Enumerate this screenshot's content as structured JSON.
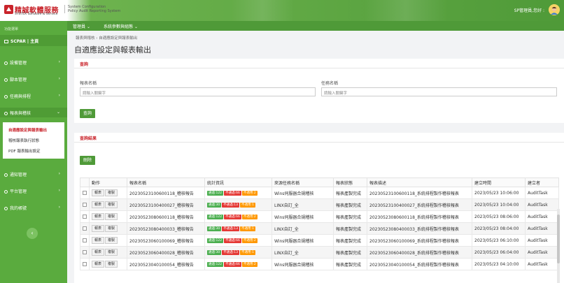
{
  "colors": {
    "brand_red": "#c9242b",
    "brand_green": "#4f9a38",
    "sidebar_green": "#5aab3e",
    "pass": "#4caf50",
    "fail": "#e53935",
    "na": "#ff9800"
  },
  "header": {
    "logo_name": "精誠軟體服務",
    "logo_sub": "SYSTEX Software & Service",
    "system_line1": "System Configuration",
    "system_line2": "Policy Audit Reporting System",
    "user_greeting": "SP管理員,您好 :",
    "avatar_icon": "user-avatar-icon"
  },
  "sidebar": {
    "section_label": "功能選單",
    "home_label": "SCPAR | 主頁",
    "items": [
      {
        "label": "設備管理"
      },
      {
        "label": "腳本管理"
      },
      {
        "label": "任務與排程"
      },
      {
        "label": "報表與稽核"
      },
      {
        "label": "通知管理"
      },
      {
        "label": "平台管理"
      },
      {
        "label": "我的帳號"
      }
    ],
    "submenu": [
      {
        "label": "自適應設定與報表輸出"
      },
      {
        "label": "稽核報表執行狀態"
      },
      {
        "label": "PDF 報表輸出設定"
      }
    ],
    "collapse_icon": "chevron-left-icon"
  },
  "menubar": {
    "items": [
      {
        "label": "管理員"
      },
      {
        "label": "系統參數與組態"
      }
    ]
  },
  "breadcrumb": "報表與稽核 › 自適應設定與報表輸出",
  "page_title": "自適應設定與報表輸出",
  "query": {
    "title": "查詢",
    "report_name_label": "報表名稱",
    "report_name_placeholder": "請輸入關鍵字",
    "task_name_label": "任務名稱",
    "task_name_placeholder": "請輸入關鍵字",
    "search_button": "查詢"
  },
  "results": {
    "title": "查詢結果",
    "delete_button": "刪除",
    "columns": [
      "動作",
      "報表名稱",
      "統計資訊",
      "來源任務名稱",
      "報表狀態",
      "報表描述",
      "建立時間",
      "建立者"
    ],
    "action_report": "報表",
    "action_copy": "複製",
    "stat_pass_prefix": "通過",
    "stat_fail_prefix": "不通過",
    "stat_na_prefix": "不適用",
    "rows": [
      {
        "name": "20230523100600118_稽核報告",
        "pass": "122",
        "fail": "66",
        "na": "2",
        "source": "Wins伺服器合規稽核",
        "status": "報表產製完成",
        "desc": "20230523100600118_系統排程製作稽核報表",
        "time": "2023/05/23 10:06:00",
        "creator": "AuditTask"
      },
      {
        "name": "20230523100400027_稽核報告",
        "pass": "30",
        "fail": "13",
        "na": "1",
        "source": "LINX自訂_全",
        "status": "報表產製完成",
        "desc": "20230523100400027_系統排程製作稽核報表",
        "time": "2023/05/23 10:04:00",
        "creator": "AuditTask"
      },
      {
        "name": "20230523080600118_稽核報告",
        "pass": "122",
        "fail": "66",
        "na": "2",
        "source": "Wins伺服器合規稽核",
        "status": "報表產製完成",
        "desc": "20230523080600118_系統排程製作稽核報表",
        "time": "2023/05/23 08:06:00",
        "creator": "AuditTask"
      },
      {
        "name": "20230523080400033_稽核報告",
        "pass": "30",
        "fail": "13",
        "na": "1",
        "source": "LINX自訂_全",
        "status": "報表產製完成",
        "desc": "20230523080400033_系統排程製作稽核報表",
        "time": "2023/05/23 08:04:00",
        "creator": "AuditTask"
      },
      {
        "name": "20230523060100069_稽核報告",
        "pass": "122",
        "fail": "66",
        "na": "2",
        "source": "Wins伺服器合規稽核",
        "status": "報表產製完成",
        "desc": "20230523060100069_系統排程製作稽核報表",
        "time": "2023/05/23 06:10:00",
        "creator": "AuditTask"
      },
      {
        "name": "20230523060400028_稽核報告",
        "pass": "30",
        "fail": "13",
        "na": "1",
        "source": "LINX自訂_全",
        "status": "報表產製完成",
        "desc": "20230523060400028_系統排程製作稽核報表",
        "time": "2023/05/23 06:04:00",
        "creator": "AuditTask"
      },
      {
        "name": "20230523040100054_稽核報告",
        "pass": "122",
        "fail": "66",
        "na": "2",
        "source": "Wins伺服器合規稽核",
        "status": "報表產製完成",
        "desc": "20230523040100054_系統排程製作稽核報表",
        "time": "2023/05/23 04:10:00",
        "creator": "AuditTask"
      }
    ]
  }
}
